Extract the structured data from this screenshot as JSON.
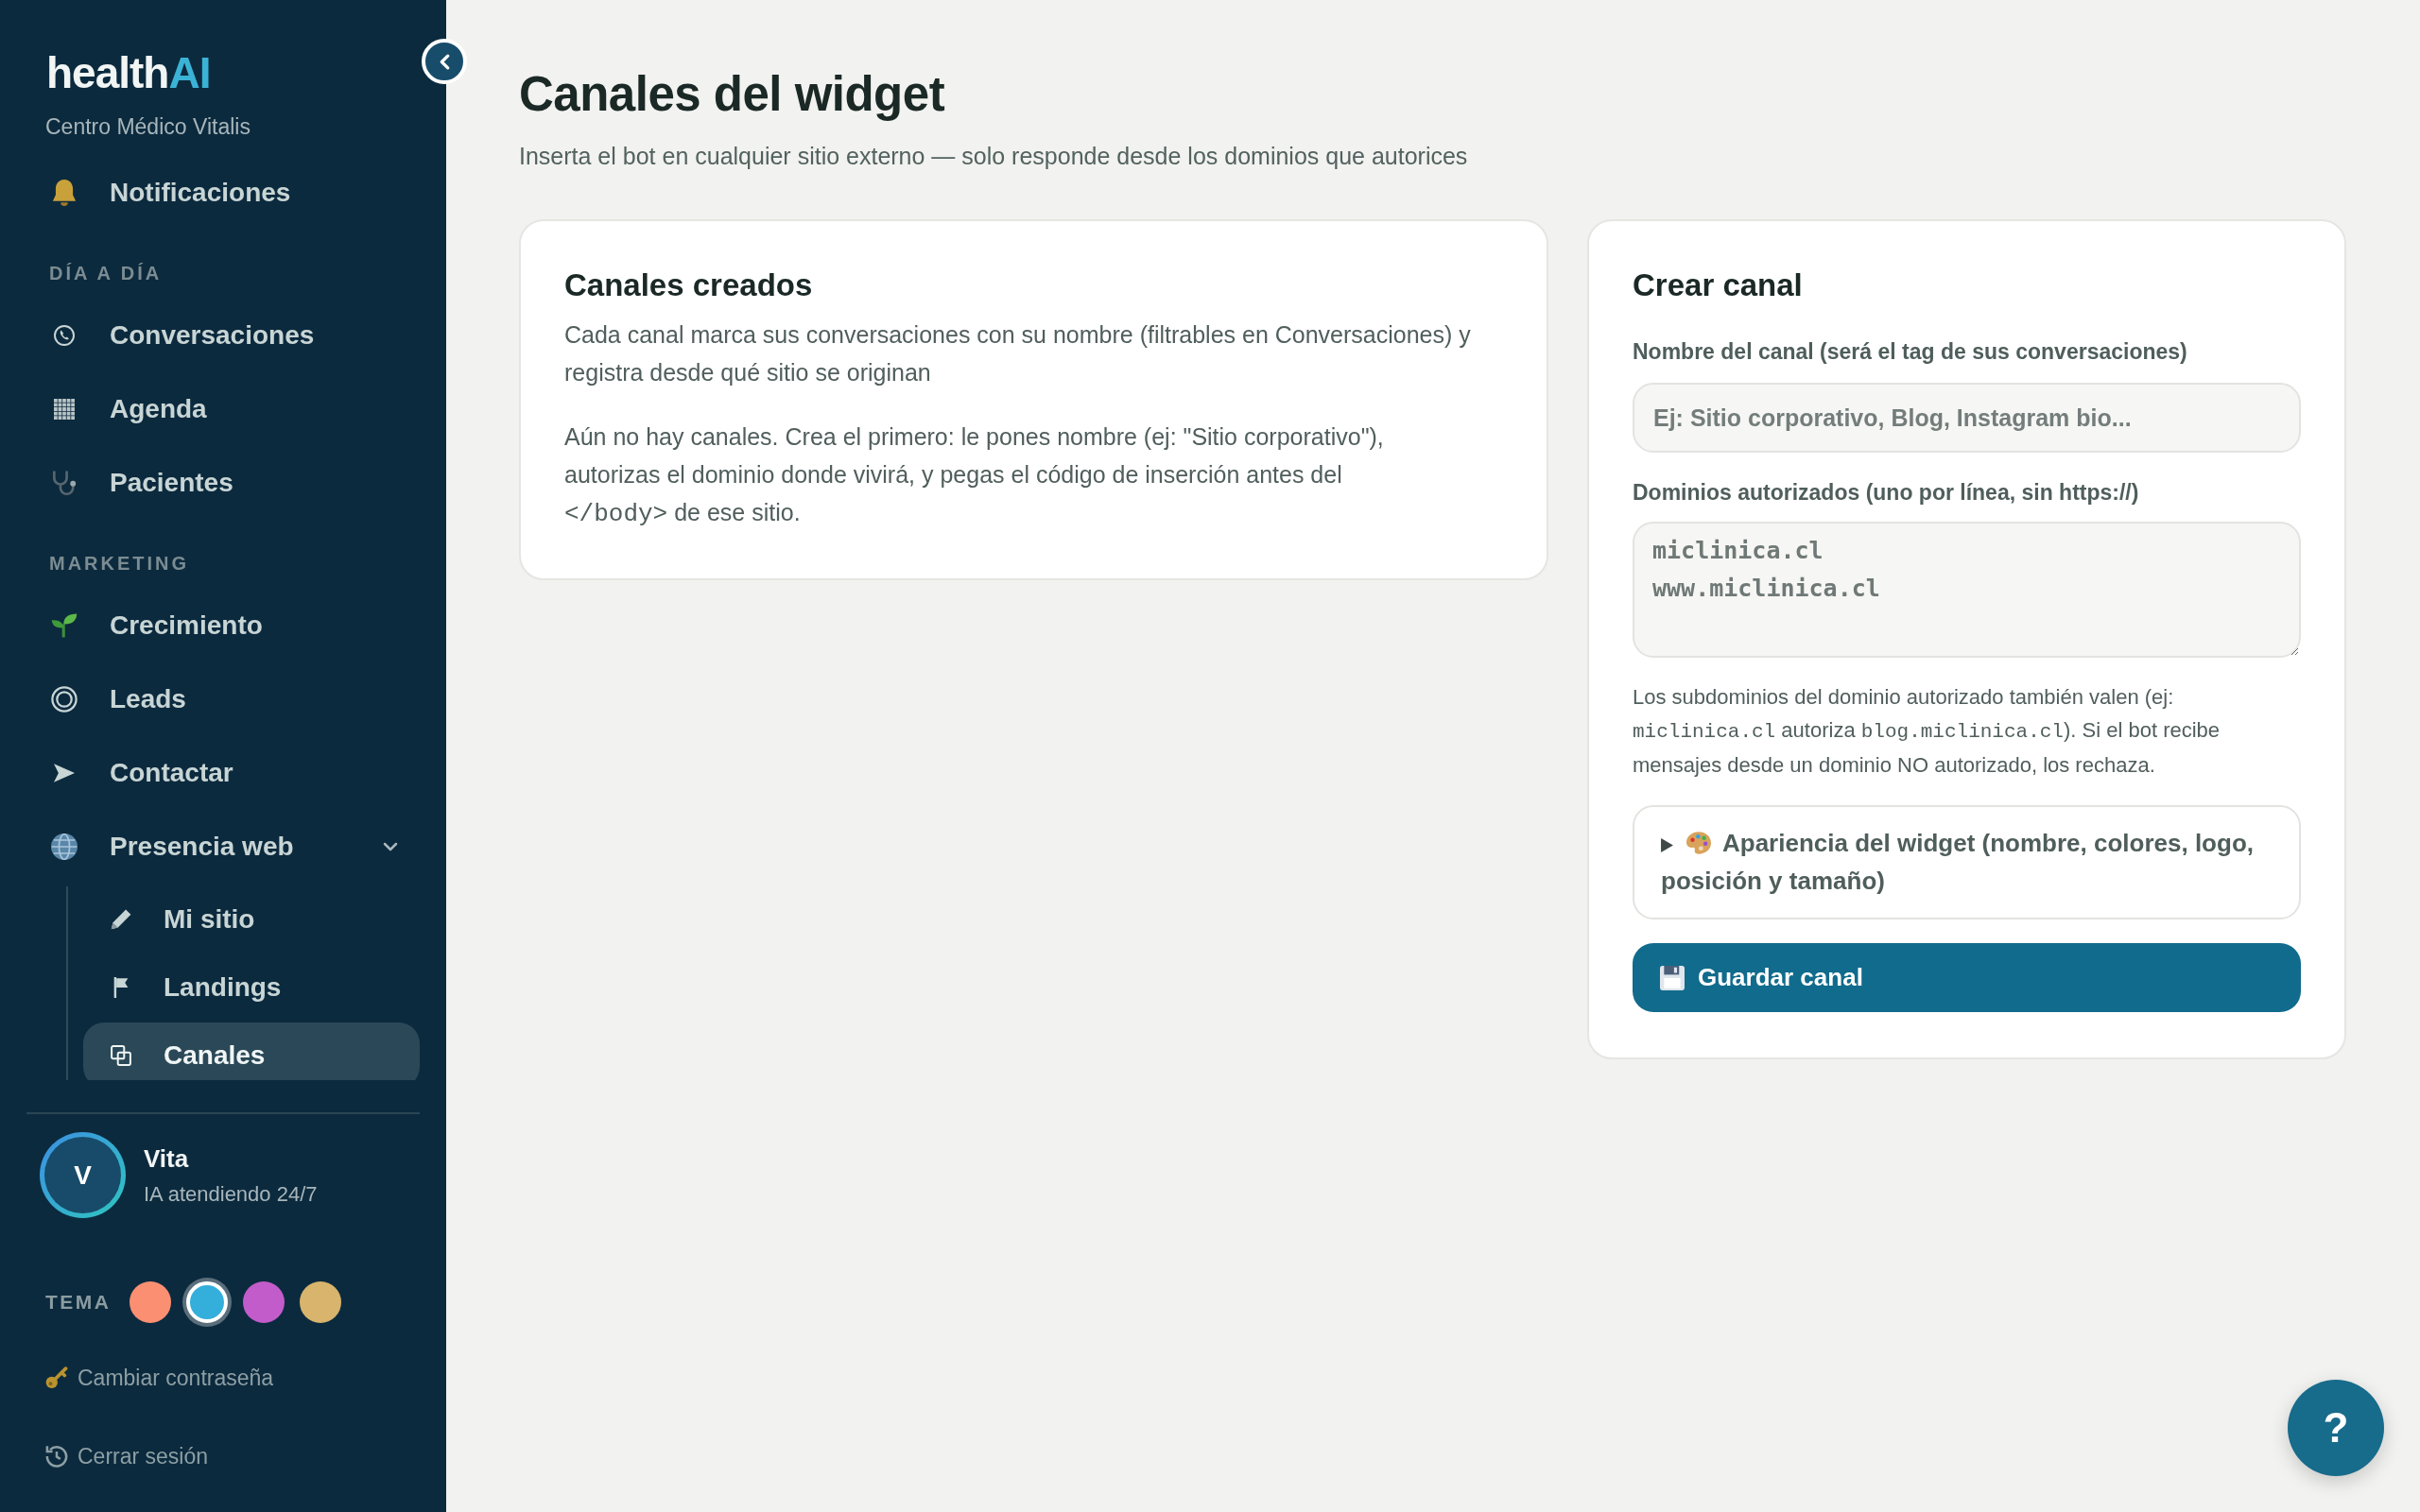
{
  "sidebar": {
    "logo": {
      "text": "health",
      "accent": "AI"
    },
    "organization": "Centro Médico Vitalis",
    "nav": [
      {
        "kind": "item",
        "label": "Notificaciones",
        "selected": false
      },
      {
        "kind": "heading",
        "label": "DÍA A DÍA"
      },
      {
        "kind": "item",
        "label": "Conversaciones",
        "selected": false
      },
      {
        "kind": "item",
        "label": "Agenda",
        "selected": false
      },
      {
        "kind": "item",
        "label": "Pacientes",
        "selected": false
      },
      {
        "kind": "heading",
        "label": "MARKETING"
      },
      {
        "kind": "item",
        "label": "Crecimiento",
        "selected": false
      },
      {
        "kind": "item",
        "label": "Leads",
        "selected": false
      },
      {
        "kind": "item",
        "label": "Contactar",
        "selected": false
      },
      {
        "kind": "item",
        "label": "Presencia web",
        "selected": false,
        "expanded": true,
        "children": [
          {
            "label": "Mi sitio",
            "selected": false
          },
          {
            "label": "Landings",
            "selected": false
          },
          {
            "label": "Canales",
            "selected": true
          }
        ]
      }
    ],
    "assistant": {
      "initial": "V",
      "name": "Vita",
      "status": "IA atendiendo 24/7"
    },
    "theme": {
      "label": "TEMA",
      "swatches": [
        {
          "color": "#fb8f72",
          "selected": false
        },
        {
          "color": "#34aedb",
          "selected": true
        },
        {
          "color": "#c25ccb",
          "selected": false
        },
        {
          "color": "#d8b46c",
          "selected": false
        }
      ]
    },
    "links": [
      {
        "label": "Cambiar contraseña"
      },
      {
        "label": "Cerrar sesión"
      }
    ]
  },
  "header": {
    "title": "Canales del widget",
    "subtitle": "Inserta el bot en cualquier sitio externo — solo responde desde los dominios que autorices"
  },
  "channels_card": {
    "title": "Canales creados",
    "description": "Cada canal marca sus conversaciones con su nombre (filtrables en Conversaciones) y registra desde qué sitio se originan",
    "empty_message": [
      {
        "kind": "text",
        "text": "Aún no hay canales. Crea el primero: le pones nombre (ej: \"Sitio corporativo\"), autorizas el dominio donde vivirá, y pegas el código de inserción antes del "
      },
      {
        "kind": "code",
        "text": "</body>"
      },
      {
        "kind": "text",
        "text": " de ese sitio."
      }
    ]
  },
  "create_card": {
    "title": "Crear canal",
    "name_field": {
      "label": "Nombre del canal (será el tag de sus conversaciones)",
      "placeholder": "Ej: Sitio corporativo, Blog, Instagram bio..."
    },
    "domains_field": {
      "label": "Dominios autorizados (uno por línea, sin https://)",
      "placeholder": "miclinica.cl\nwww.miclinica.cl"
    },
    "help": [
      {
        "kind": "text",
        "text": "Los subdominios del dominio autorizado también valen (ej: "
      },
      {
        "kind": "code",
        "text": "miclinica.cl"
      },
      {
        "kind": "text",
        "text": " autoriza "
      },
      {
        "kind": "code",
        "text": "blog.miclinica.cl"
      },
      {
        "kind": "text",
        "text": "). Si el bot recibe mensajes desde un dominio NO autorizado, los rechaza."
      }
    ],
    "appearance": {
      "label": "Apariencia del widget (nombre, colores, logo, posición y tamaño)",
      "expanded": false
    },
    "save_button": {
      "label": "Guardar canal"
    }
  },
  "help_button": {
    "label": "?"
  }
}
